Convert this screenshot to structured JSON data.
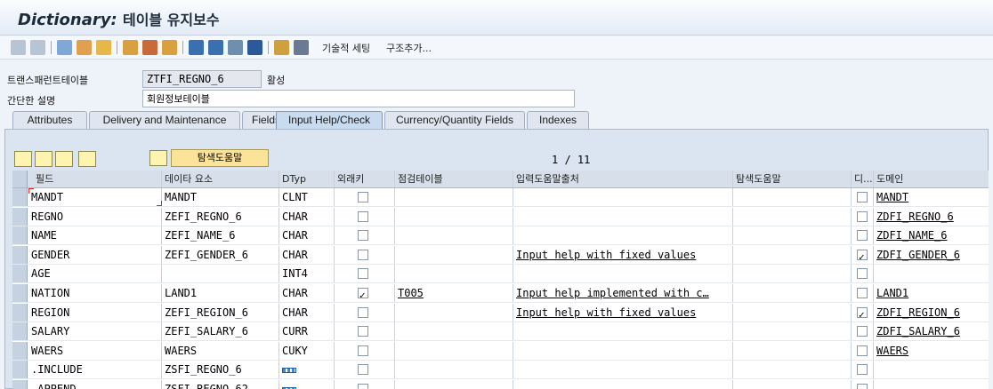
{
  "title": {
    "italic": "Dictionary:",
    "rest": "테이블 유지보수"
  },
  "toolbar": {
    "technical_settings": "기술적 세팅",
    "append_structure": "구조추가..."
  },
  "header": {
    "table_label": "트랜스패런트테이블",
    "table_name": "ZTFI_REGNO_6",
    "status": "활성",
    "desc_label": "간단한 설명",
    "description": "회원정보테이블"
  },
  "tabs": [
    "Attributes",
    "Delivery and Maintenance",
    "Fields",
    "Input Help/Check",
    "Currency/Quantity Fields",
    "Indexes"
  ],
  "active_tab": "Input Help/Check",
  "buttons": {
    "search_help": "탐색도움말"
  },
  "pager": "1 / 11",
  "columns": [
    "필드",
    "데이타 요소",
    "DTyp",
    "외래키",
    "점검테이블",
    "입력도움말출처",
    "탐색도움말",
    "디...",
    "도메인"
  ],
  "rows": [
    {
      "field": "MANDT",
      "element": "MANDT",
      "dtyp": "CLNT",
      "fk": false,
      "check": "",
      "source": "",
      "shlp": "",
      "d": false,
      "domain": "MANDT"
    },
    {
      "field": "REGNO",
      "element": "ZEFI_REGNO_6",
      "dtyp": "CHAR",
      "fk": false,
      "check": "",
      "source": "",
      "shlp": "",
      "d": false,
      "domain": "ZDFI_REGNO_6"
    },
    {
      "field": "NAME",
      "element": "ZEFI_NAME_6",
      "dtyp": "CHAR",
      "fk": false,
      "check": "",
      "source": "",
      "shlp": "",
      "d": false,
      "domain": "ZDFI_NAME_6"
    },
    {
      "field": "GENDER",
      "element": "ZEFI_GENDER_6",
      "dtyp": "CHAR",
      "fk": false,
      "check": "",
      "source": "Input help with fixed values",
      "shlp": "",
      "d": true,
      "domain": "ZDFI_GENDER_6"
    },
    {
      "field": "AGE",
      "element": "",
      "dtyp": "INT4",
      "fk": false,
      "check": "",
      "source": "",
      "shlp": "",
      "d": false,
      "domain": ""
    },
    {
      "field": "NATION",
      "element": "LAND1",
      "dtyp": "CHAR",
      "fk": true,
      "check": "T005",
      "source": "Input help implemented with c…",
      "shlp": "",
      "d": false,
      "domain": "LAND1"
    },
    {
      "field": "REGION",
      "element": "ZEFI_REGION_6",
      "dtyp": "CHAR",
      "fk": false,
      "check": "",
      "source": "Input help with fixed values",
      "shlp": "",
      "d": true,
      "domain": "ZDFI_REGION_6"
    },
    {
      "field": "SALARY",
      "element": "ZEFI_SALARY_6",
      "dtyp": "CURR",
      "fk": false,
      "check": "",
      "source": "",
      "shlp": "",
      "d": false,
      "domain": "ZDFI_SALARY_6"
    },
    {
      "field": "WAERS",
      "element": "WAERS",
      "dtyp": "CUKY",
      "fk": false,
      "check": "",
      "source": "",
      "shlp": "",
      "d": false,
      "domain": "WAERS"
    },
    {
      "field": ".INCLUDE",
      "element": "ZSFI_REGNO_6",
      "dtyp": "",
      "fk": false,
      "check": "",
      "source": "",
      "shlp": "",
      "d": false,
      "domain": ""
    },
    {
      "field": ".APPEND",
      "element": "ZSFI_REGNO_62",
      "dtyp": "",
      "fk": false,
      "check": "",
      "source": "",
      "shlp": "",
      "d": false,
      "domain": ""
    }
  ],
  "colors": {
    "accent": "#c9dbef",
    "button": "#fbe49a",
    "link": "#000000"
  }
}
